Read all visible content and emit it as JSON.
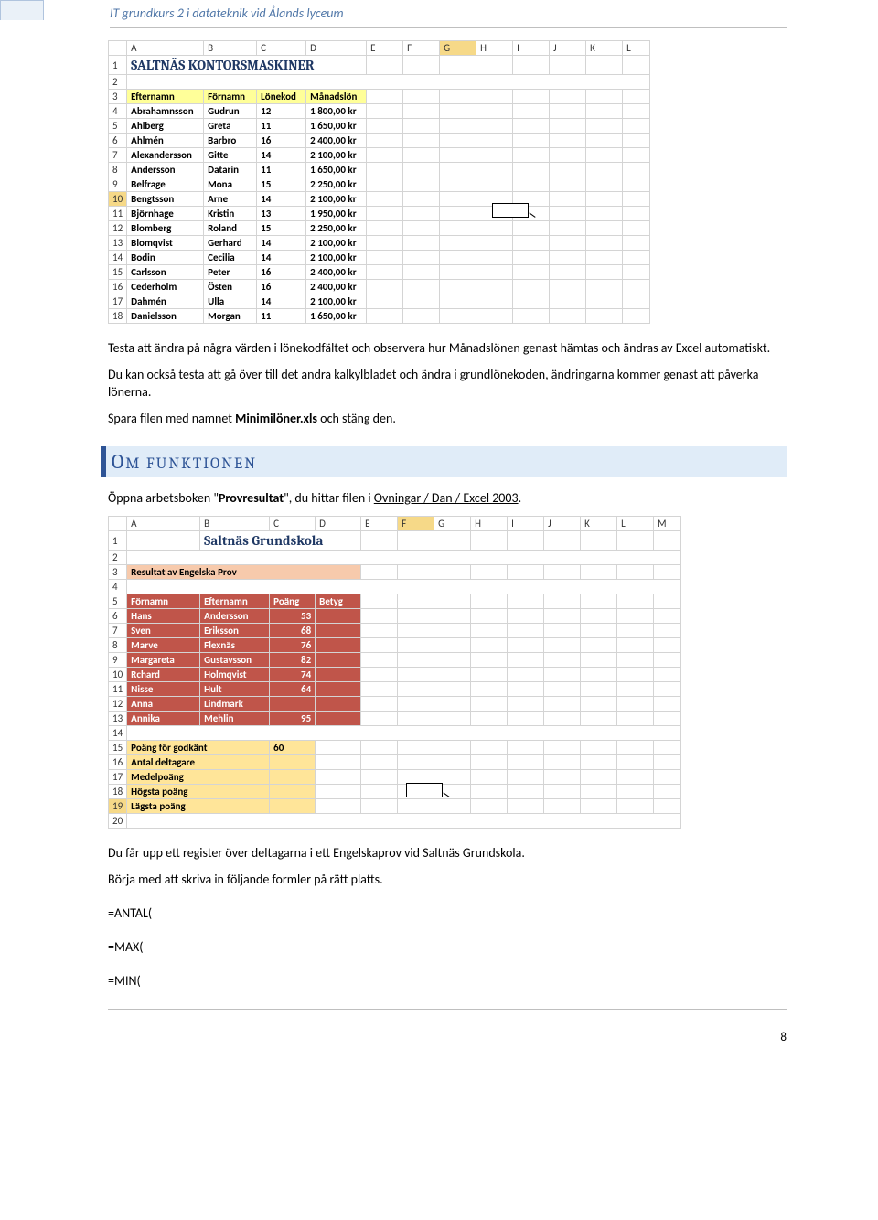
{
  "header": {
    "title": "IT grundkurs 2 i datateknik vid Ålands lyceum"
  },
  "sheet1": {
    "cols": [
      "A",
      "B",
      "C",
      "D",
      "E",
      "F",
      "G",
      "H",
      "I",
      "J",
      "K",
      "L"
    ],
    "title": "SALTNÄS KONTORSMASKINER",
    "headers": {
      "a": "Efternamn",
      "b": "Förnamn",
      "c": "Lönekod",
      "d": "Månadslön"
    },
    "rows": [
      {
        "n": "4",
        "a": "Abrahamnsson",
        "b": "Gudrun",
        "c": "12",
        "d": "1 800,00 kr"
      },
      {
        "n": "5",
        "a": "Ahlberg",
        "b": "Greta",
        "c": "11",
        "d": "1 650,00 kr"
      },
      {
        "n": "6",
        "a": "Ahlmén",
        "b": "Barbro",
        "c": "16",
        "d": "2 400,00 kr"
      },
      {
        "n": "7",
        "a": "Alexandersson",
        "b": "Gitte",
        "c": "14",
        "d": "2 100,00 kr"
      },
      {
        "n": "8",
        "a": "Andersson",
        "b": "Datarin",
        "c": "11",
        "d": "1 650,00 kr"
      },
      {
        "n": "9",
        "a": "Belfrage",
        "b": "Mona",
        "c": "15",
        "d": "2 250,00 kr"
      },
      {
        "n": "10",
        "a": "Bengtsson",
        "b": "Arne",
        "c": "14",
        "d": "2 100,00 kr"
      },
      {
        "n": "11",
        "a": "Björnhage",
        "b": "Kristin",
        "c": "13",
        "d": "1 950,00 kr"
      },
      {
        "n": "12",
        "a": "Blomberg",
        "b": "Roland",
        "c": "15",
        "d": "2 250,00 kr"
      },
      {
        "n": "13",
        "a": "Blomqvist",
        "b": "Gerhard",
        "c": "14",
        "d": "2 100,00 kr"
      },
      {
        "n": "14",
        "a": "Bodin",
        "b": "Cecilia",
        "c": "14",
        "d": "2 100,00 kr"
      },
      {
        "n": "15",
        "a": "Carlsson",
        "b": "Peter",
        "c": "16",
        "d": "2 400,00 kr"
      },
      {
        "n": "16",
        "a": "Cederholm",
        "b": "Östen",
        "c": "16",
        "d": "2 400,00 kr"
      },
      {
        "n": "17",
        "a": "Dahmén",
        "b": "Ulla",
        "c": "14",
        "d": "2 100,00 kr"
      },
      {
        "n": "18",
        "a": "Danielsson",
        "b": "Morgan",
        "c": "11",
        "d": "1 650,00 kr"
      }
    ],
    "selected_col": "G",
    "selected_row": "10"
  },
  "body": {
    "p1": "Testa att ändra på några värden i lönekodfältet och observera hur Månadslönen genast hämtas och ändras av Excel automatiskt.",
    "p2": "Du kan också testa att gå över till det andra kalkylbladet och ändra i grundlönekoden, ändringarna kommer genast att påverka lönerna.",
    "p3a": "Spara filen med namnet ",
    "p3b": "Minimilöner.xls",
    "p3c": " och stäng den.",
    "heading_cap": "O",
    "heading_rest": "M FUNKTIONEN",
    "p4a": "Öppna arbetsboken \"",
    "p4b": "Provresultat",
    "p4c": "\", du hittar filen i ",
    "p4d": "Ovningar / Dan / Excel 2003",
    "p4e": "."
  },
  "sheet2": {
    "cols": [
      "A",
      "B",
      "C",
      "D",
      "E",
      "F",
      "G",
      "H",
      "I",
      "J",
      "K",
      "L",
      "M"
    ],
    "title": "Saltnäs Grundskola",
    "sub": "Resultat av Engelska Prov",
    "headers": {
      "a": "Förnamn",
      "b": "Efternamn",
      "c": "Poäng",
      "d": "Betyg"
    },
    "rows": [
      {
        "n": "6",
        "a": "Hans",
        "b": "Andersson",
        "c": "53",
        "d": ""
      },
      {
        "n": "7",
        "a": "Sven",
        "b": "Eriksson",
        "c": "68",
        "d": ""
      },
      {
        "n": "8",
        "a": "Marve",
        "b": "Flexnäs",
        "c": "76",
        "d": ""
      },
      {
        "n": "9",
        "a": "Margareta",
        "b": "Gustavsson",
        "c": "82",
        "d": ""
      },
      {
        "n": "10",
        "a": "Rchard",
        "b": "Holmqvist",
        "c": "74",
        "d": ""
      },
      {
        "n": "11",
        "a": "Nisse",
        "b": "Hult",
        "c": "64",
        "d": ""
      },
      {
        "n": "12",
        "a": "Anna",
        "b": "Lindmark",
        "c": "",
        "d": ""
      },
      {
        "n": "13",
        "a": "Annika",
        "b": "Mehlin",
        "c": "95",
        "d": ""
      }
    ],
    "footer": [
      {
        "n": "15",
        "label": "Poäng för godkänt",
        "val": "60"
      },
      {
        "n": "16",
        "label": "Antal deltagare",
        "val": ""
      },
      {
        "n": "17",
        "label": "Medelpoäng",
        "val": ""
      },
      {
        "n": "18",
        "label": "Högsta poäng",
        "val": ""
      },
      {
        "n": "19",
        "label": "Lägsta poäng",
        "val": ""
      }
    ],
    "selected_col": "F",
    "selected_row": "19"
  },
  "body2": {
    "p1": "Du får upp ett register över deltagarna i ett Engelskaprov vid Saltnäs Grundskola.",
    "p2": "Börja med att skriva in följande formler på rätt platts.",
    "f1": "=ANTAL(",
    "f2": "=MAX(",
    "f3": "=MIN("
  },
  "page_number": "8"
}
